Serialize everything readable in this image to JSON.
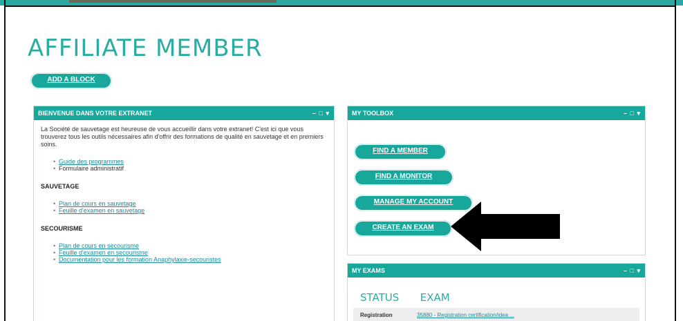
{
  "page": {
    "title": "AFFILIATE MEMBER"
  },
  "toolbar": {
    "add_block_label": "ADD A BLOCK"
  },
  "welcome_panel": {
    "title": "BIENVENUE DANS VOTRE EXTRANET",
    "controls": "– □ ▾",
    "intro": "La Société de sauvetage est heureuse de vous accueillir dans votre extranet! C'est ici que vous trouverez tous les outils nécessaires afin d'offrir des formations de qualité en sauvetage et en premiers soins.",
    "general_links": [
      {
        "label": "Guide des programmes",
        "link": true
      },
      {
        "label": "Formulaire administratif",
        "link": false
      }
    ],
    "sauvetage_heading": "SAUVETAGE",
    "sauvetage_links": [
      {
        "label": "Plan de cours en sauvetage"
      },
      {
        "label": "Feuille d'examen en sauvetage"
      }
    ],
    "secourisme_heading": "SECOURISME",
    "secourisme_links": [
      {
        "label": "Plan de cours en secourisme"
      },
      {
        "label": "Feuille d'examen en secourisme"
      },
      {
        "label": "Documentation pour les formation Anaphylaxie-secouristes"
      }
    ]
  },
  "toolbox_panel": {
    "title": "MY TOOLBOX",
    "controls": "– □ ▾",
    "buttons": [
      {
        "label": "FIND A MEMBER"
      },
      {
        "label": "FIND A MONITOR"
      },
      {
        "label": "MANAGE MY ACCOUNT"
      },
      {
        "label": "CREATE AN EXAM"
      }
    ]
  },
  "exams_panel": {
    "title": "MY EXAMS",
    "controls": "– □ ▾",
    "col_status": "STATUS",
    "col_exam": "EXAM",
    "rows": [
      {
        "status": "Registration",
        "exam": "35880 - Registration certification/idea ..."
      }
    ]
  },
  "colors": {
    "accent": "#17a79b",
    "title": "#29ada2",
    "link": "#1a8c99"
  }
}
